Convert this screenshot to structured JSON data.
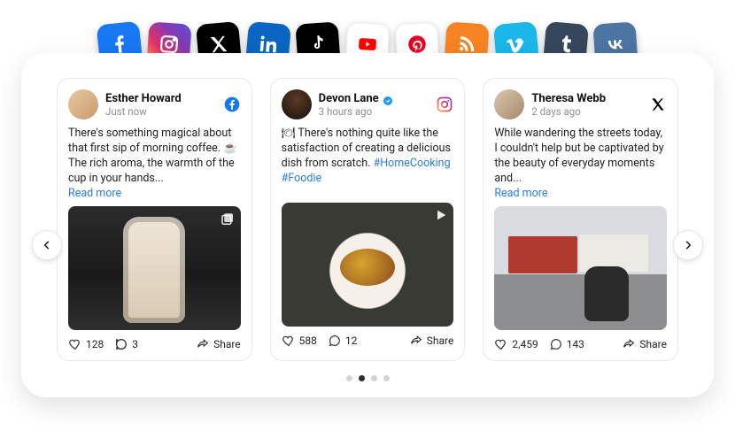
{
  "topIcons": [
    "facebook",
    "instagram",
    "x",
    "linkedin",
    "tiktok",
    "youtube",
    "pinterest",
    "rss",
    "vimeo",
    "tumblr",
    "vk"
  ],
  "pagination": {
    "count": 4,
    "active": 1
  },
  "posts": [
    {
      "author": "Esther Howard",
      "time": "Just now",
      "verified": false,
      "network": "facebook",
      "body_pre": "There's something magical about that first sip of morning coffee. ☕ The rich aroma, the warmth of the cup in your hands...",
      "hashtags": "",
      "read_more": "Read more",
      "media_kind": "carousel",
      "likes": "128",
      "comments": "3",
      "share": "Share"
    },
    {
      "author": "Devon Lane",
      "time": "3 hours ago",
      "verified": true,
      "network": "instagram",
      "body_pre": "🍽 There's nothing quite like the satisfaction of creating a delicious dish from scratch. ",
      "hashtags": "#HomeCooking #Foodie",
      "read_more": "",
      "media_kind": "video",
      "likes": "588",
      "comments": "12",
      "share": "Share"
    },
    {
      "author": "Theresa Webb",
      "time": "2 days ago",
      "verified": false,
      "network": "x",
      "body_pre": "While wandering the streets today, I couldn't help but be captivated by the beauty of everyday moments and...",
      "hashtags": "",
      "read_more": "Read more",
      "media_kind": "",
      "likes": "2,459",
      "comments": "143",
      "share": "Share"
    }
  ]
}
